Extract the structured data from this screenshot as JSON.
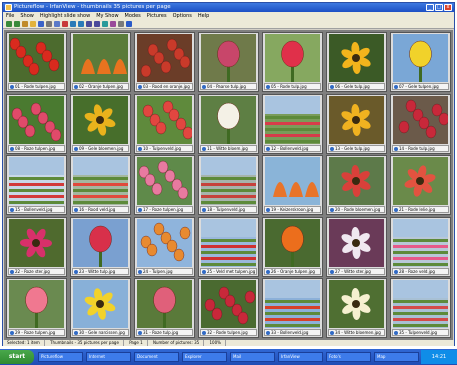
{
  "window": {
    "title": "Pictureflow - IrfanView - thumbnails 35 pictures per page",
    "minimize_label": "_",
    "maximize_label": "□",
    "close_label": "x"
  },
  "menu": [
    "File",
    "Show",
    "Highlight slide show",
    "My Show",
    "Modes",
    "Pictures",
    "Options",
    "Help"
  ],
  "toolbar_icons": [
    "back-icon",
    "forward-icon",
    "home-icon",
    "folder-icon",
    "save-icon",
    "print-icon",
    "copy-icon",
    "delete-icon",
    "rotate-left-icon",
    "rotate-right-icon",
    "zoom-in-icon",
    "zoom-out-icon",
    "slideshow-icon",
    "grid-view-icon",
    "settings-icon",
    "help-icon"
  ],
  "thumbnails": [
    {
      "caption": "01 - Rode tulpen.jpg",
      "bg": "#4c6b2e",
      "flower": "#d92a1e",
      "style": "tulip-cluster"
    },
    {
      "caption": "02 - Oranje tulpen.jpg",
      "bg": "#5a7b3a",
      "flower": "#e8731f",
      "style": "fringed"
    },
    {
      "caption": "03 - Rood en oranje.jpg",
      "bg": "#6b3d28",
      "flower": "#c93a2a",
      "style": "tulip-cluster"
    },
    {
      "caption": "04 - Paarse tulp.jpg",
      "bg": "#6f7a4a",
      "flower": "#c8466a",
      "style": "single"
    },
    {
      "caption": "05 - Rode tulp.jpg",
      "bg": "#86a860",
      "flower": "#e0304a",
      "style": "single"
    },
    {
      "caption": "06 - Gele tulp.jpg",
      "bg": "#3b5a26",
      "flower": "#f2b41c",
      "style": "star"
    },
    {
      "caption": "07 - Gele tulpen.jpg",
      "bg": "#7aa7d6",
      "flower": "#f1d22a",
      "style": "single"
    },
    {
      "caption": "08 - Roze tulpen.jpg",
      "bg": "#4a7a30",
      "flower": "#e04a6a",
      "style": "tulip-cluster"
    },
    {
      "caption": "09 - Gele bloemen.jpg",
      "bg": "#476e2b",
      "flower": "#e9b21c",
      "style": "star"
    },
    {
      "caption": "10 - Tulpenveld.jpg",
      "bg": "#5f8a3c",
      "flower": "#e24640",
      "style": "tulip-cluster"
    },
    {
      "caption": "11 - Witte bloem.jpg",
      "bg": "#5e7f44",
      "flower": "#f4f1e6",
      "style": "single"
    },
    {
      "caption": "12 - Bollenveld.jpg",
      "bg": "#7a9c5a",
      "flower": "#d73c4a",
      "style": "field"
    },
    {
      "caption": "13 - Gele tulp.jpg",
      "bg": "#6a5a2a",
      "flower": "#f0b220",
      "style": "star"
    },
    {
      "caption": "14 - Rode tulp.jpg",
      "bg": "#6b5a4a",
      "flower": "#c8283a",
      "style": "tulip-cluster"
    },
    {
      "caption": "15 - Bollenveld.jpg",
      "bg": "#c8d8e8",
      "flower": "#d23a3a",
      "style": "field"
    },
    {
      "caption": "16 - Rood veld.jpg",
      "bg": "#a4b8a0",
      "flower": "#e04a3c",
      "style": "field"
    },
    {
      "caption": "17 - Roze tulpen.jpg",
      "bg": "#5f8a4a",
      "flower": "#e87aa0",
      "style": "tulip-cluster"
    },
    {
      "caption": "18 - Tulpenveld.jpg",
      "bg": "#a6b4ad",
      "flower": "#c6423c",
      "style": "field"
    },
    {
      "caption": "19 - Keizerskroon.jpg",
      "bg": "#8ab4d8",
      "flower": "#e8742a",
      "style": "fringed"
    },
    {
      "caption": "20 - Rode bloemen.jpg",
      "bg": "#5d7a4a",
      "flower": "#d9403a",
      "style": "star"
    },
    {
      "caption": "21 - Rode lelie.jpg",
      "bg": "#6a8a4a",
      "flower": "#e25340",
      "style": "star"
    },
    {
      "caption": "22 - Roze ster.jpg",
      "bg": "#4f6a2e",
      "flower": "#d8306a",
      "style": "star"
    },
    {
      "caption": "23 - Witte tulp.jpg",
      "bg": "#7aa0d0",
      "flower": "#d8304a",
      "style": "single"
    },
    {
      "caption": "24 - Tulpen.jpg",
      "bg": "#8fb4dc",
      "flower": "#e88a30",
      "style": "tulip-cluster"
    },
    {
      "caption": "25 - Veld met tulpen.jpg",
      "bg": "#9ab8dc",
      "flower": "#cf3030",
      "style": "field"
    },
    {
      "caption": "26 - Oranje tulpen.jpg",
      "bg": "#4a6a30",
      "flower": "#ec6e1c",
      "style": "single"
    },
    {
      "caption": "27 - Witte ster.jpg",
      "bg": "#6a3a58",
      "flower": "#f0e8f0",
      "style": "star"
    },
    {
      "caption": "28 - Roze veld.jpg",
      "bg": "#b8c8d8",
      "flower": "#e65a8a",
      "style": "field"
    },
    {
      "caption": "29 - Roze tulpen.jpg",
      "bg": "#6a8a50",
      "flower": "#f07890",
      "style": "single"
    },
    {
      "caption": "30 - Gele narcissen.jpg",
      "bg": "#88b0d8",
      "flower": "#f2d22a",
      "style": "star"
    },
    {
      "caption": "31 - Roze tulp.jpg",
      "bg": "#5a7a3a",
      "flower": "#e0607a",
      "style": "single"
    },
    {
      "caption": "32 - Rode tulpen.jpg",
      "bg": "#4a6a30",
      "flower": "#c8283a",
      "style": "tulip-cluster"
    },
    {
      "caption": "33 - Bollenveld.jpg",
      "bg": "#8cb0d8",
      "flower": "#d6402a",
      "style": "field"
    },
    {
      "caption": "34 - Witte bloemen.jpg",
      "bg": "#4f6f32",
      "flower": "#f6f0d0",
      "style": "star"
    },
    {
      "caption": "35 - Tulpenveld.jpg",
      "bg": "#a8c0d4",
      "flower": "#d44a4a",
      "style": "field"
    }
  ],
  "statusbar": {
    "left": "Selected: 1 item",
    "middle": "Thumbnails - 35 pictures per page",
    "page": "Page 1",
    "count": "Number of pictures: 35",
    "zoom": "100%"
  },
  "taskbar": {
    "start_label": "start",
    "tasks": [
      "Pictureflow",
      "Internet",
      "Document",
      "Explorer",
      "Mail",
      "IrfanView",
      "Foto's",
      "Map"
    ],
    "clock": "14:21"
  },
  "colors": {
    "selection": "#316ac5",
    "grid_bg": "#7f7f7f"
  }
}
